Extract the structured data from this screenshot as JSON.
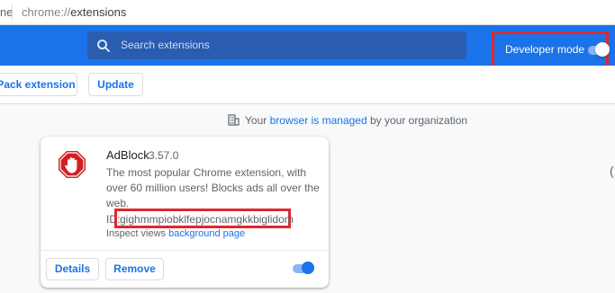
{
  "address_bar": {
    "left_fragment": "ne",
    "url_scheme": "chrome://",
    "url_path": "extensions"
  },
  "header": {
    "search_placeholder": "Search extensions",
    "developer_mode_label": "Developer mode",
    "developer_mode_on": true
  },
  "actions": {
    "pack_label": "Pack extension",
    "update_label": "Update"
  },
  "managed_notice": {
    "prefix": "Your",
    "link": "browser is managed",
    "suffix": "by your organization"
  },
  "extension": {
    "name": "AdBlock",
    "version": "3.57.0",
    "description": "The most popular Chrome extension, with over 60 million users! Blocks ads all over the web.",
    "id_label": "ID:",
    "id_value": "gighmmpiobklfepjocnamgkkbiglidom",
    "inspect_label": "Inspect views",
    "inspect_link": "background page",
    "details_label": "Details",
    "remove_label": "Remove",
    "enabled": true
  },
  "colors": {
    "toolbar": "#1a73e8",
    "highlight": "#e0272f",
    "adblock_red": "#d11f22"
  },
  "icons": [
    "search-icon",
    "building-icon",
    "adblock-hand-icon"
  ]
}
